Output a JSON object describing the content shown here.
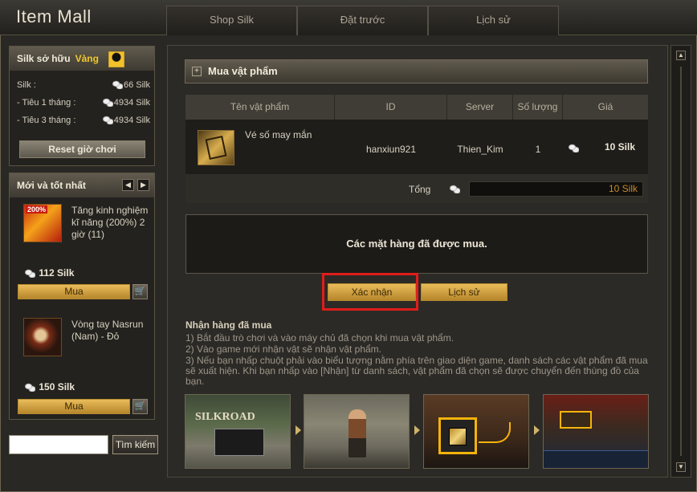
{
  "app": {
    "title": "Item Mall"
  },
  "tabs": [
    {
      "label": "Shop Silk"
    },
    {
      "label": "Đặt trước"
    },
    {
      "label": "Lịch sử"
    }
  ],
  "silk_box": {
    "header": "Silk sở hữu",
    "tier": "Vàng",
    "rows": [
      {
        "label": "Silk :",
        "value": "66 Silk"
      },
      {
        "label": "- Tiêu 1 tháng :",
        "value": "4934 Silk"
      },
      {
        "label": "- Tiêu 3 tháng :",
        "value": "4934 Silk"
      }
    ],
    "reset_button": "Reset giờ chơi"
  },
  "new_box": {
    "header": "Mới và tốt nhất",
    "prev": "◀",
    "next": "▶",
    "items": [
      {
        "badge": "200%",
        "name": "Tăng kinh nghiệm kĩ năng (200%) 2 giờ (11)",
        "price": "112 Silk",
        "buy": "Mua"
      },
      {
        "name": "Vòng tay Nasrun (Nam) - Đỏ",
        "price": "150 Silk",
        "buy": "Mua"
      }
    ]
  },
  "search": {
    "value": "",
    "button": "Tìm kiếm"
  },
  "purchase": {
    "section_title": "Mua vật phẩm",
    "columns": [
      "Tên vật phẩm",
      "ID",
      "Server",
      "Số lượng",
      "Giá"
    ],
    "row": {
      "name": "Vé số may mắn",
      "id": "hanxiun921",
      "server": "Thien_Kim",
      "quantity": "1",
      "price": "10 Silk"
    },
    "total_label": "Tổng",
    "total_value": "10 Silk",
    "message": "Các mặt hàng đã được mua.",
    "confirm_button": "Xác nhận",
    "history_button": "Lịch sử"
  },
  "instructions": {
    "title": "Nhận hàng đã mua",
    "lines": [
      "1) Bắt đầu trò chơi và vào máy chủ đã chọn khi mua vật phẩm.",
      "2) Vào game mới nhận vật sẽ nhận vật phẩm.",
      "3) Nếu bạn nhấp chuột phải vào biểu tượng nằm phía trên giao diện game, danh sách các vật phẩm đã mua sẽ xuất hiện. Khi bạn nhấp vào [Nhận] từ danh sách, vật phẩm đã chọn sẽ được chuyển đến thùng đồ của bạn."
    ],
    "screenshot_logo": "SILKROAD"
  },
  "colors": {
    "accent_gold": "#e9bc5a",
    "highlight_red": "#e01d1a",
    "tier_gold": "#f1c72b",
    "total_orange": "#c98a2b"
  },
  "icons": [
    "close-icon",
    "coin-icon",
    "cart-icon",
    "plus-icon",
    "arrow-left-icon",
    "arrow-right-icon",
    "scroll-up-icon",
    "scroll-down-icon"
  ]
}
